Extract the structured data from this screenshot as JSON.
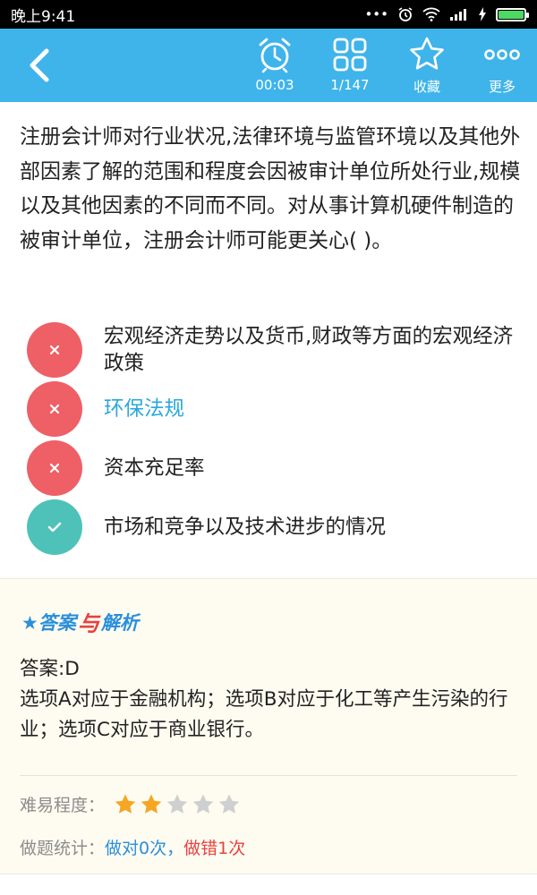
{
  "status_bar": {
    "time": "晚上9:41",
    "battery_level": 1.0
  },
  "toolbar": {
    "timer_value": "00:03",
    "progress_value": "1/147",
    "favorite_label": "收藏",
    "more_label": "更多"
  },
  "question": {
    "text": "注册会计师对行业状况,法律环境与监管环境以及其他外部因素了解的范围和程度会因被审计单位所处行业,规模以及其他因素的不同而不同。对从事计算机硬件制造的被审计单位，注册会计师可能更关心(   )。"
  },
  "options": [
    {
      "text": "宏观经济走势以及货币,财政等方面的宏观经济政策",
      "result": "wrong"
    },
    {
      "text": "环保法规",
      "result": "wrong"
    },
    {
      "text": "资本充足率",
      "result": "wrong"
    },
    {
      "text": "市场和竞争以及技术进步的情况",
      "result": "right"
    }
  ],
  "analysis": {
    "heading_left": "★答案",
    "heading_mid": "与",
    "heading_right": "解析",
    "answer_line": "答案:D",
    "explanation": "选项A对应于金融机构；选项B对应于化工等产生污染的行业；选项C对应于商业银行。",
    "difficulty_label": "难易程度：",
    "difficulty_rating": 2,
    "difficulty_max": 5,
    "stats_label": "做题统计：",
    "stats_right": "做对0次",
    "stats_sep": "，",
    "stats_wrong": "做错1次"
  },
  "colors": {
    "toolbar": "#3fb4ea",
    "wrong": "#ef5f66",
    "right": "#4ec2b9",
    "star_on": "#f5a623",
    "star_off": "#cfcfcf"
  }
}
